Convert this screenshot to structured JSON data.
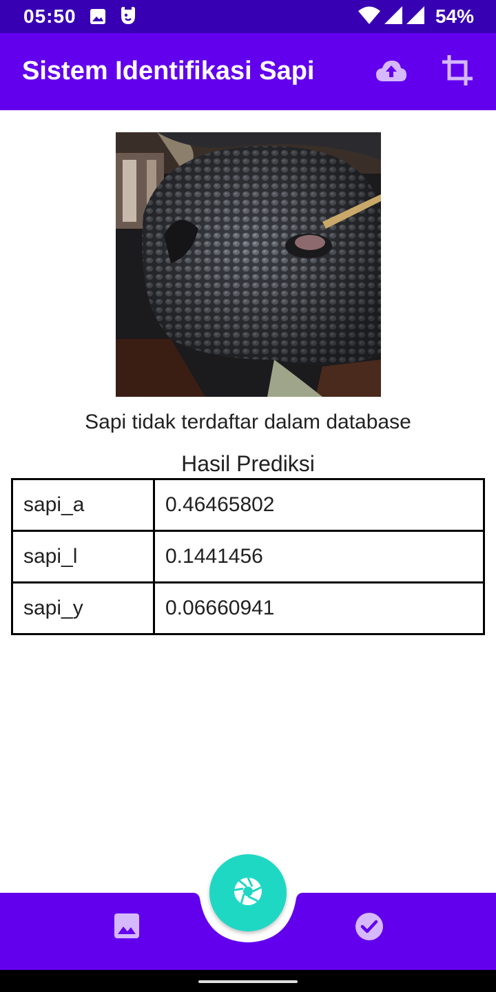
{
  "status_bar": {
    "time": "05:50",
    "battery": "54%",
    "icons": [
      "image-icon",
      "app-notification-icon",
      "wifi-icon",
      "signal-icon",
      "signal-icon",
      "battery-text"
    ]
  },
  "app_bar": {
    "title": "Sistem Identifikasi Sapi",
    "actions": [
      "cloud-upload-icon",
      "crop-icon"
    ],
    "background": "#6200ee"
  },
  "photo": {
    "subject": "close-up of cow muzzle"
  },
  "result": {
    "message": "Sapi tidak terdaftar dalam database",
    "table_title": "Hasil Prediksi",
    "rows": [
      {
        "label": "sapi_a",
        "value": "0.46465802"
      },
      {
        "label": "sapi_l",
        "value": "0.1441456"
      },
      {
        "label": "sapi_y",
        "value": "0.06660941"
      }
    ]
  },
  "bottom_bar": {
    "left_icon": "image-icon",
    "right_icon": "check-circle-icon",
    "fab_icon": "camera-shutter-icon",
    "fab_color": "#1ed8c4",
    "background": "#6200ee"
  },
  "colors": {
    "status_bar": "#3700b3",
    "primary": "#6200ee",
    "icon_tint": "#d6b8ff"
  }
}
